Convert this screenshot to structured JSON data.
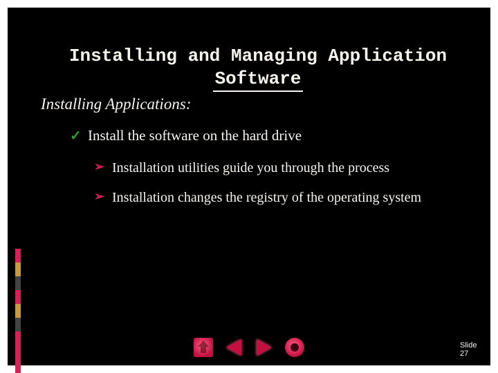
{
  "title": "Installing and Managing Application Software",
  "subtitle": "Installing Applications:",
  "level1": {
    "bullet": "✓",
    "text": "Install the software on the hard drive"
  },
  "level2": [
    {
      "bullet": "➢",
      "text": "Installation utilities guide you through the process"
    },
    {
      "bullet": "➢",
      "text": "Installation changes the registry of the operating system"
    }
  ],
  "page_label": "Slide 27"
}
